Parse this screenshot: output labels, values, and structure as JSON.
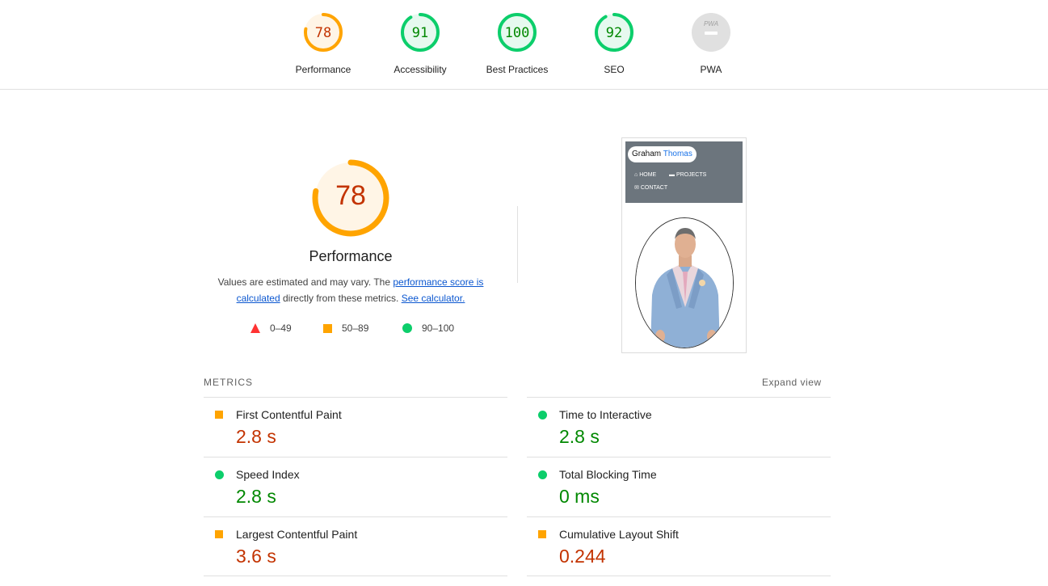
{
  "summary": [
    {
      "score": "78",
      "label": "Performance",
      "rating": "average",
      "color": "#ffa400",
      "value": 0.78
    },
    {
      "score": "91",
      "label": "Accessibility",
      "rating": "pass",
      "color": "#0cce6b",
      "value": 0.91
    },
    {
      "score": "100",
      "label": "Best Practices",
      "rating": "pass",
      "color": "#0cce6b",
      "value": 1.0
    },
    {
      "score": "92",
      "label": "SEO",
      "rating": "pass",
      "color": "#0cce6b",
      "value": 0.92
    },
    {
      "score": "",
      "label": "PWA",
      "badge_text": "PWA",
      "rating": "na",
      "color": "#c8c8c8"
    }
  ],
  "performance": {
    "score": "78",
    "value": 0.78,
    "title": "Performance",
    "desc_prefix": "Values are estimated and may vary. The ",
    "desc_link1": "performance score is calculated",
    "desc_middle": " directly from these metrics. ",
    "desc_link2": "See calculator."
  },
  "legend": [
    {
      "shape": "triangle",
      "range": "0–49",
      "color": "#ff3333"
    },
    {
      "shape": "square",
      "range": "50–89",
      "color": "#ffa400"
    },
    {
      "shape": "circle",
      "range": "90–100",
      "color": "#0cce6b"
    }
  ],
  "screenshot": {
    "brand_first": "Graham",
    "brand_second": "Thomas",
    "nav": [
      "HOME",
      "PROJECTS",
      "CONTACT"
    ]
  },
  "metrics_section": {
    "title": "METRICS",
    "expand_label": "Expand view",
    "left": [
      {
        "label": "First Contentful Paint",
        "value": "2.8 s",
        "rating": "average"
      },
      {
        "label": "Speed Index",
        "value": "2.8 s",
        "rating": "pass"
      },
      {
        "label": "Largest Contentful Paint",
        "value": "3.6 s",
        "rating": "average"
      }
    ],
    "right": [
      {
        "label": "Time to Interactive",
        "value": "2.8 s",
        "rating": "pass"
      },
      {
        "label": "Total Blocking Time",
        "value": "0 ms",
        "rating": "pass"
      },
      {
        "label": "Cumulative Layout Shift",
        "value": "0.244",
        "rating": "average"
      }
    ]
  }
}
